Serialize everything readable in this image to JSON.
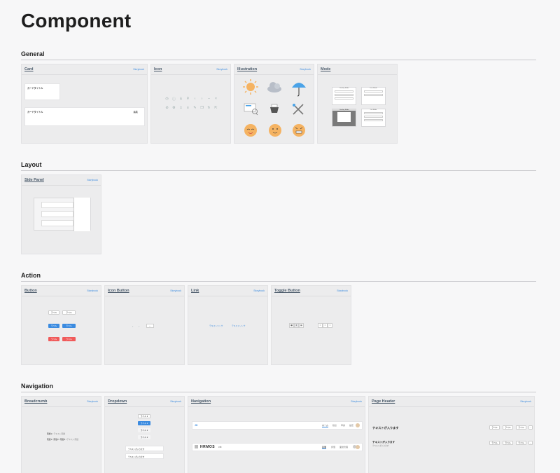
{
  "page": {
    "title": "Component"
  },
  "sections": {
    "general": "General",
    "layout": "Layout",
    "action": "Action",
    "navigation": "Navigation"
  },
  "link_label": "Storybook",
  "cards": {
    "card": {
      "title": "Card",
      "card_title_1": "カードタイトル",
      "card_title_2": "カードタイトル",
      "badge": "編集"
    },
    "icon": {
      "title": "Icon"
    },
    "illustration": {
      "title": "Illustration"
    },
    "mode": {
      "title": "Mode",
      "labels": [
        "Overlay Mode",
        "Icon Mode",
        "Overlay Mode",
        "List Mode"
      ]
    },
    "side_panel": {
      "title": "Side Panel"
    },
    "button": {
      "title": "Button",
      "labels": [
        "ラベル",
        "ラベル",
        "ラベル",
        "ラベル",
        "ラベル",
        "ラベル"
      ]
    },
    "icon_button": {
      "title": "Icon Button"
    },
    "link": {
      "title": "Link",
      "labels": [
        "テキストリンク",
        "テキストリンク"
      ]
    },
    "toggle_button": {
      "title": "Toggle Button"
    },
    "breadcrumb": {
      "title": "Breadcrumb",
      "rows": [
        [
          "階層1",
          "テキスト階層"
        ],
        [
          "階層1",
          "階層2",
          "階層3",
          "テキスト階層"
        ]
      ]
    },
    "dropdown": {
      "title": "Dropdown",
      "options": [
        "ラベル",
        "ラベル",
        "ラベル",
        "ラベル"
      ],
      "fields": [
        "テキストが入ります",
        "テキストが入ります"
      ]
    },
    "navigation": {
      "title": "Navigation",
      "logo_1": "JK",
      "tabs_1": [
        "ホーム",
        "勤怠",
        "申請",
        "設定"
      ],
      "logo_2": "HRMOS",
      "logo_2_sub": "ctx",
      "tabs_2": [
        "従業",
        "評価",
        "面談管理"
      ]
    },
    "page_header": {
      "title": "Page Header",
      "heading_1": "テキストが入ります",
      "heading_2": "テキストが入ります",
      "sub_2": "テキストが入ります",
      "buttons": [
        "ラベル",
        "ラベル",
        "ラベル",
        "ラベル",
        "ラベル",
        "ラベル"
      ]
    }
  },
  "colors": {
    "accent": "#3b8be0",
    "danger": "#f05a5a",
    "sun": "#f5b362",
    "umbrella": "#4aa3e8"
  }
}
